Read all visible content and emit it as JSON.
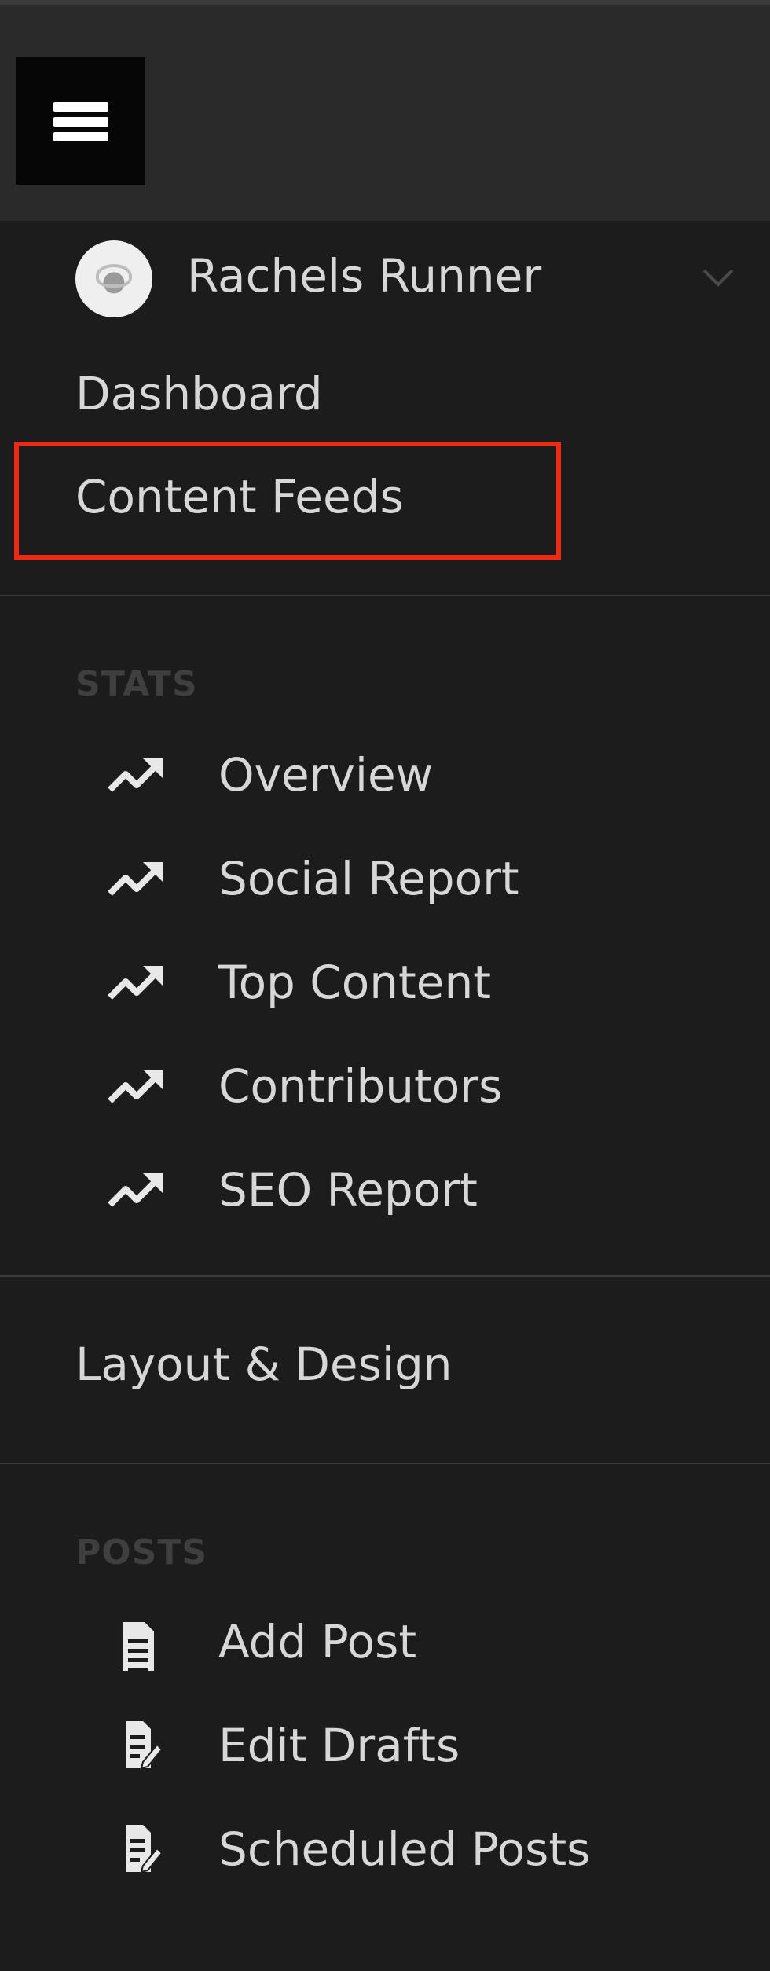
{
  "header": {
    "menu_icon": "hamburger-icon"
  },
  "profile": {
    "name": "Rachels Runner",
    "avatar_icon": "avatar",
    "dropdown_icon": "chevron-down-icon"
  },
  "nav": {
    "dashboard": "Dashboard",
    "content_feeds": "Content Feeds",
    "layout_design": "Layout & Design",
    "highlight_color": "#f02a10"
  },
  "stats": {
    "title": "STATS",
    "icon": "trending-up-icon",
    "items": [
      {
        "label": "Overview"
      },
      {
        "label": "Social Report"
      },
      {
        "label": "Top Content"
      },
      {
        "label": "Contributors"
      },
      {
        "label": "SEO Report"
      }
    ]
  },
  "posts": {
    "title": "POSTS",
    "items": [
      {
        "label": "Add Post",
        "icon": "document-icon"
      },
      {
        "label": "Edit Drafts",
        "icon": "edit-document-icon"
      },
      {
        "label": "Scheduled Posts",
        "icon": "edit-document-icon"
      }
    ]
  }
}
